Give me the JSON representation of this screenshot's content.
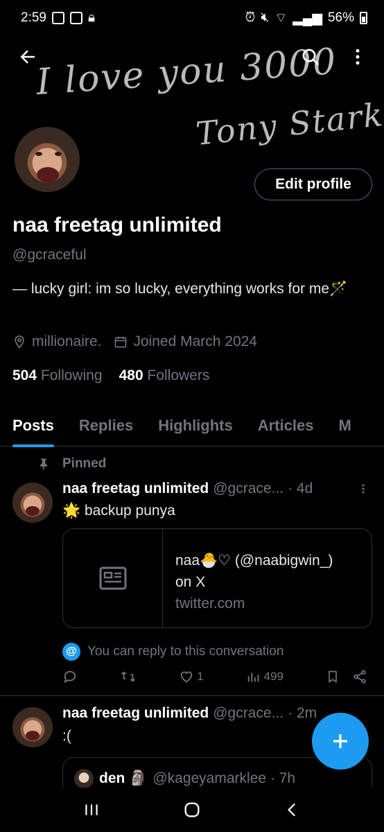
{
  "status_bar": {
    "time": "2:59",
    "battery": "56%"
  },
  "banner": {
    "line1": "I love you 3000",
    "line2": "Tony Stark"
  },
  "profile": {
    "edit_button": "Edit profile",
    "display_name": "naa freetag unlimited",
    "handle": "@gcraceful",
    "bio": "— lucky girl: im so lucky, everything works for me🪄",
    "location": "millionaire.",
    "joined": "Joined March 2024",
    "following_count": "504",
    "following_label": "Following",
    "followers_count": "480",
    "followers_label": "Followers"
  },
  "tabs": [
    {
      "label": "Posts",
      "active": true
    },
    {
      "label": "Replies"
    },
    {
      "label": "Highlights"
    },
    {
      "label": "Articles"
    },
    {
      "label": "M"
    }
  ],
  "pinned_label": "Pinned",
  "tweets": [
    {
      "name": "naa freetag unlimited",
      "handle": "@gcrace...",
      "time": "· 4d",
      "text": "🌟 backup punya",
      "card": {
        "title_line1": "naa🐣♡ (@naabigwin_)",
        "title_line2": "on X",
        "domain": "twitter.com"
      },
      "reply_note": "You can reply to this conversation",
      "likes": "1",
      "views": "499"
    },
    {
      "name": "naa freetag unlimited",
      "handle": "@gcrace...",
      "time": "· 2m",
      "text": ":(",
      "quote": {
        "name": "den 🗿",
        "handle": "@kageyamarklee · 7h"
      }
    }
  ],
  "accent": "#1d9bf0"
}
